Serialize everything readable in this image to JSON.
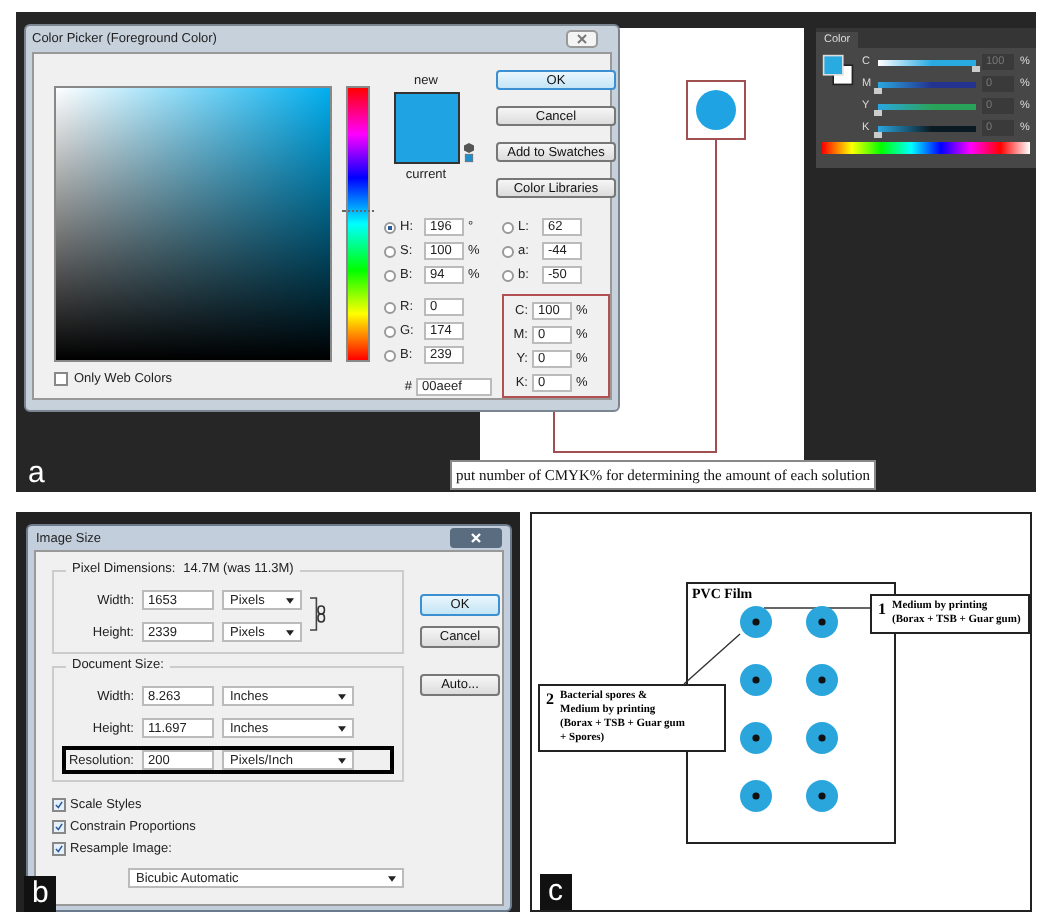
{
  "panel_a": {
    "label": "a",
    "dialog": {
      "title": "Color Picker (Foreground Color)",
      "new_label": "new",
      "current_label": "current",
      "buttons": [
        {
          "label": "OK",
          "default": true
        },
        {
          "label": "Cancel",
          "default": false
        },
        {
          "label": "Add to Swatches",
          "default": false
        },
        {
          "label": "Color Libraries",
          "default": false
        }
      ],
      "hsb_fields": [
        {
          "label": "H:",
          "value": "196",
          "unit": "°",
          "selected": true
        },
        {
          "label": "S:",
          "value": "100",
          "unit": "%",
          "selected": false
        },
        {
          "label": "B:",
          "value": "94",
          "unit": "%",
          "selected": false
        }
      ],
      "rgb_fields": [
        {
          "label": "R:",
          "value": "0",
          "selected": false
        },
        {
          "label": "G:",
          "value": "174",
          "selected": false
        },
        {
          "label": "B:",
          "value": "239",
          "selected": false
        }
      ],
      "lab_fields": [
        {
          "label": "L:",
          "value": "62",
          "selected": false
        },
        {
          "label": "a:",
          "value": "-44",
          "selected": false
        },
        {
          "label": "b:",
          "value": "-50",
          "selected": false
        }
      ],
      "cmyk_fields": [
        {
          "label": "C:",
          "value": "100",
          "unit": "%"
        },
        {
          "label": "M:",
          "value": "0",
          "unit": "%"
        },
        {
          "label": "Y:",
          "value": "0",
          "unit": "%"
        },
        {
          "label": "K:",
          "value": "0",
          "unit": "%"
        }
      ],
      "hex": {
        "symbol": "#",
        "value": "00aeef"
      },
      "hue_slider": {
        "level": 0.544
      },
      "only_web_colors": {
        "label": "Only Web Colors",
        "checked": false
      }
    },
    "color_panel": {
      "title": "Color",
      "sliders": [
        {
          "label": "C",
          "level": 1,
          "value": "100",
          "unit": "%",
          "color": "#29abe2"
        },
        {
          "label": "M",
          "level": 0,
          "value": "0",
          "unit": "%",
          "color": "#24338f"
        },
        {
          "label": "Y",
          "level": 0,
          "value": "0",
          "unit": "%",
          "color": "#2aa35a"
        },
        {
          "label": "K",
          "level": 0,
          "value": "0",
          "unit": "%",
          "color": "#0a1a22"
        }
      ]
    },
    "annotation": "put number of CMYK% for determining the amount of each solution"
  },
  "panel_b": {
    "label": "b",
    "dialog": {
      "title": "Image Size",
      "pixel_dimensions": {
        "label": "Pixel Dimensions:",
        "value": "14.7M (was 11.3M)",
        "rows": [
          {
            "label": "Width:",
            "value": "1653",
            "unit": "Pixels",
            "highlighted": false
          },
          {
            "label": "Height:",
            "value": "2339",
            "unit": "Pixels",
            "highlighted": false
          }
        ]
      },
      "document_size": {
        "label": "Document Size:",
        "rows": [
          {
            "label": "Width:",
            "value": "8.263",
            "unit": "Inches",
            "highlighted": false
          },
          {
            "label": "Height:",
            "value": "11.697",
            "unit": "Inches",
            "highlighted": false
          },
          {
            "label": "Resolution:",
            "value": "200",
            "unit": "Pixels/Inch",
            "highlighted": true
          }
        ]
      },
      "buttons": [
        {
          "label": "OK",
          "default": true
        },
        {
          "label": "Cancel",
          "default": false
        },
        {
          "label": "Auto...",
          "default": false
        }
      ],
      "checkboxes": [
        {
          "label": "Scale Styles",
          "checked": true
        },
        {
          "label": "Constrain Proportions",
          "checked": true
        },
        {
          "label": "Resample Image:",
          "checked": true
        }
      ],
      "resample_method": "Bicubic Automatic"
    }
  },
  "panel_c": {
    "label": "c",
    "film_label": "PVC Film",
    "callouts": [
      {
        "number": "1",
        "text": "Medium by printing\n(Borax + TSB + Guar gum)"
      },
      {
        "number": "2",
        "text": "Bacterial spores &\nMedium by printing\n(Borax + TSB + Guar gum\n+ Spores)"
      }
    ]
  }
}
